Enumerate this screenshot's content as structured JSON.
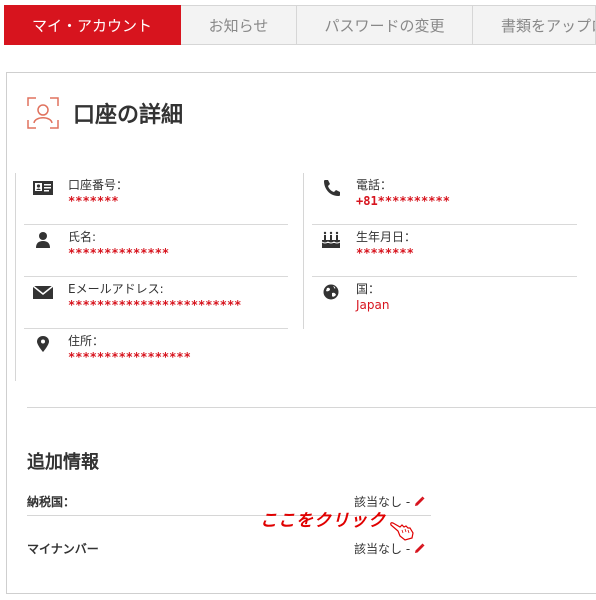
{
  "tabs": [
    {
      "label": "マイ・アカウント",
      "active": true
    },
    {
      "label": "お知らせ",
      "active": false
    },
    {
      "label": "パスワードの変更",
      "active": false
    },
    {
      "label": "書類をアップロ",
      "active": false
    }
  ],
  "account": {
    "title": "口座の詳細",
    "left_fields": [
      {
        "icon": "id-card-icon",
        "label": "口座番号：",
        "value": "*******"
      },
      {
        "icon": "user-icon",
        "label": "氏名:",
        "value": "**************"
      },
      {
        "icon": "envelope-icon",
        "label": "Eメールアドレス:",
        "value": "************************"
      },
      {
        "icon": "map-pin-icon",
        "label": "住所：",
        "value": "*****************"
      }
    ],
    "right_fields": [
      {
        "icon": "phone-icon",
        "label": "電話：",
        "value": "+81**********"
      },
      {
        "icon": "birthday-cake-icon",
        "label": "生年月日：",
        "value": "********"
      },
      {
        "icon": "globe-icon",
        "label": "国：",
        "value": "Japan"
      }
    ]
  },
  "additional": {
    "title": "追加情報",
    "rows": [
      {
        "label": "納税国：",
        "value": "該当なし -"
      },
      {
        "label": "マイナンバー",
        "value": "該当なし -"
      }
    ]
  },
  "annotation": {
    "text": "ここをクリック"
  },
  "colors": {
    "accent": "#d7141e",
    "note": "#e00000"
  }
}
